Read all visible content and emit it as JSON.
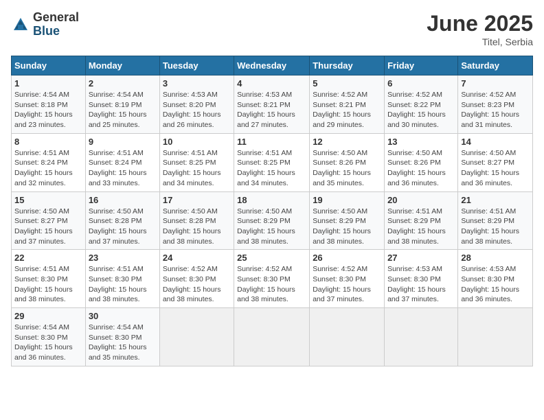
{
  "header": {
    "logo_general": "General",
    "logo_blue": "Blue",
    "month_year": "June 2025",
    "location": "Titel, Serbia"
  },
  "weekdays": [
    "Sunday",
    "Monday",
    "Tuesday",
    "Wednesday",
    "Thursday",
    "Friday",
    "Saturday"
  ],
  "weeks": [
    [
      {
        "day": 1,
        "sunrise": "4:54 AM",
        "sunset": "8:18 PM",
        "daylight": "15 hours and 23 minutes."
      },
      {
        "day": 2,
        "sunrise": "4:54 AM",
        "sunset": "8:19 PM",
        "daylight": "15 hours and 25 minutes."
      },
      {
        "day": 3,
        "sunrise": "4:53 AM",
        "sunset": "8:20 PM",
        "daylight": "15 hours and 26 minutes."
      },
      {
        "day": 4,
        "sunrise": "4:53 AM",
        "sunset": "8:21 PM",
        "daylight": "15 hours and 27 minutes."
      },
      {
        "day": 5,
        "sunrise": "4:52 AM",
        "sunset": "8:21 PM",
        "daylight": "15 hours and 29 minutes."
      },
      {
        "day": 6,
        "sunrise": "4:52 AM",
        "sunset": "8:22 PM",
        "daylight": "15 hours and 30 minutes."
      },
      {
        "day": 7,
        "sunrise": "4:52 AM",
        "sunset": "8:23 PM",
        "daylight": "15 hours and 31 minutes."
      }
    ],
    [
      {
        "day": 8,
        "sunrise": "4:51 AM",
        "sunset": "8:24 PM",
        "daylight": "15 hours and 32 minutes."
      },
      {
        "day": 9,
        "sunrise": "4:51 AM",
        "sunset": "8:24 PM",
        "daylight": "15 hours and 33 minutes."
      },
      {
        "day": 10,
        "sunrise": "4:51 AM",
        "sunset": "8:25 PM",
        "daylight": "15 hours and 34 minutes."
      },
      {
        "day": 11,
        "sunrise": "4:51 AM",
        "sunset": "8:25 PM",
        "daylight": "15 hours and 34 minutes."
      },
      {
        "day": 12,
        "sunrise": "4:50 AM",
        "sunset": "8:26 PM",
        "daylight": "15 hours and 35 minutes."
      },
      {
        "day": 13,
        "sunrise": "4:50 AM",
        "sunset": "8:26 PM",
        "daylight": "15 hours and 36 minutes."
      },
      {
        "day": 14,
        "sunrise": "4:50 AM",
        "sunset": "8:27 PM",
        "daylight": "15 hours and 36 minutes."
      }
    ],
    [
      {
        "day": 15,
        "sunrise": "4:50 AM",
        "sunset": "8:27 PM",
        "daylight": "15 hours and 37 minutes."
      },
      {
        "day": 16,
        "sunrise": "4:50 AM",
        "sunset": "8:28 PM",
        "daylight": "15 hours and 37 minutes."
      },
      {
        "day": 17,
        "sunrise": "4:50 AM",
        "sunset": "8:28 PM",
        "daylight": "15 hours and 38 minutes."
      },
      {
        "day": 18,
        "sunrise": "4:50 AM",
        "sunset": "8:29 PM",
        "daylight": "15 hours and 38 minutes."
      },
      {
        "day": 19,
        "sunrise": "4:50 AM",
        "sunset": "8:29 PM",
        "daylight": "15 hours and 38 minutes."
      },
      {
        "day": 20,
        "sunrise": "4:51 AM",
        "sunset": "8:29 PM",
        "daylight": "15 hours and 38 minutes."
      },
      {
        "day": 21,
        "sunrise": "4:51 AM",
        "sunset": "8:29 PM",
        "daylight": "15 hours and 38 minutes."
      }
    ],
    [
      {
        "day": 22,
        "sunrise": "4:51 AM",
        "sunset": "8:30 PM",
        "daylight": "15 hours and 38 minutes."
      },
      {
        "day": 23,
        "sunrise": "4:51 AM",
        "sunset": "8:30 PM",
        "daylight": "15 hours and 38 minutes."
      },
      {
        "day": 24,
        "sunrise": "4:52 AM",
        "sunset": "8:30 PM",
        "daylight": "15 hours and 38 minutes."
      },
      {
        "day": 25,
        "sunrise": "4:52 AM",
        "sunset": "8:30 PM",
        "daylight": "15 hours and 38 minutes."
      },
      {
        "day": 26,
        "sunrise": "4:52 AM",
        "sunset": "8:30 PM",
        "daylight": "15 hours and 37 minutes."
      },
      {
        "day": 27,
        "sunrise": "4:53 AM",
        "sunset": "8:30 PM",
        "daylight": "15 hours and 37 minutes."
      },
      {
        "day": 28,
        "sunrise": "4:53 AM",
        "sunset": "8:30 PM",
        "daylight": "15 hours and 36 minutes."
      }
    ],
    [
      {
        "day": 29,
        "sunrise": "4:54 AM",
        "sunset": "8:30 PM",
        "daylight": "15 hours and 36 minutes."
      },
      {
        "day": 30,
        "sunrise": "4:54 AM",
        "sunset": "8:30 PM",
        "daylight": "15 hours and 35 minutes."
      },
      null,
      null,
      null,
      null,
      null
    ]
  ]
}
